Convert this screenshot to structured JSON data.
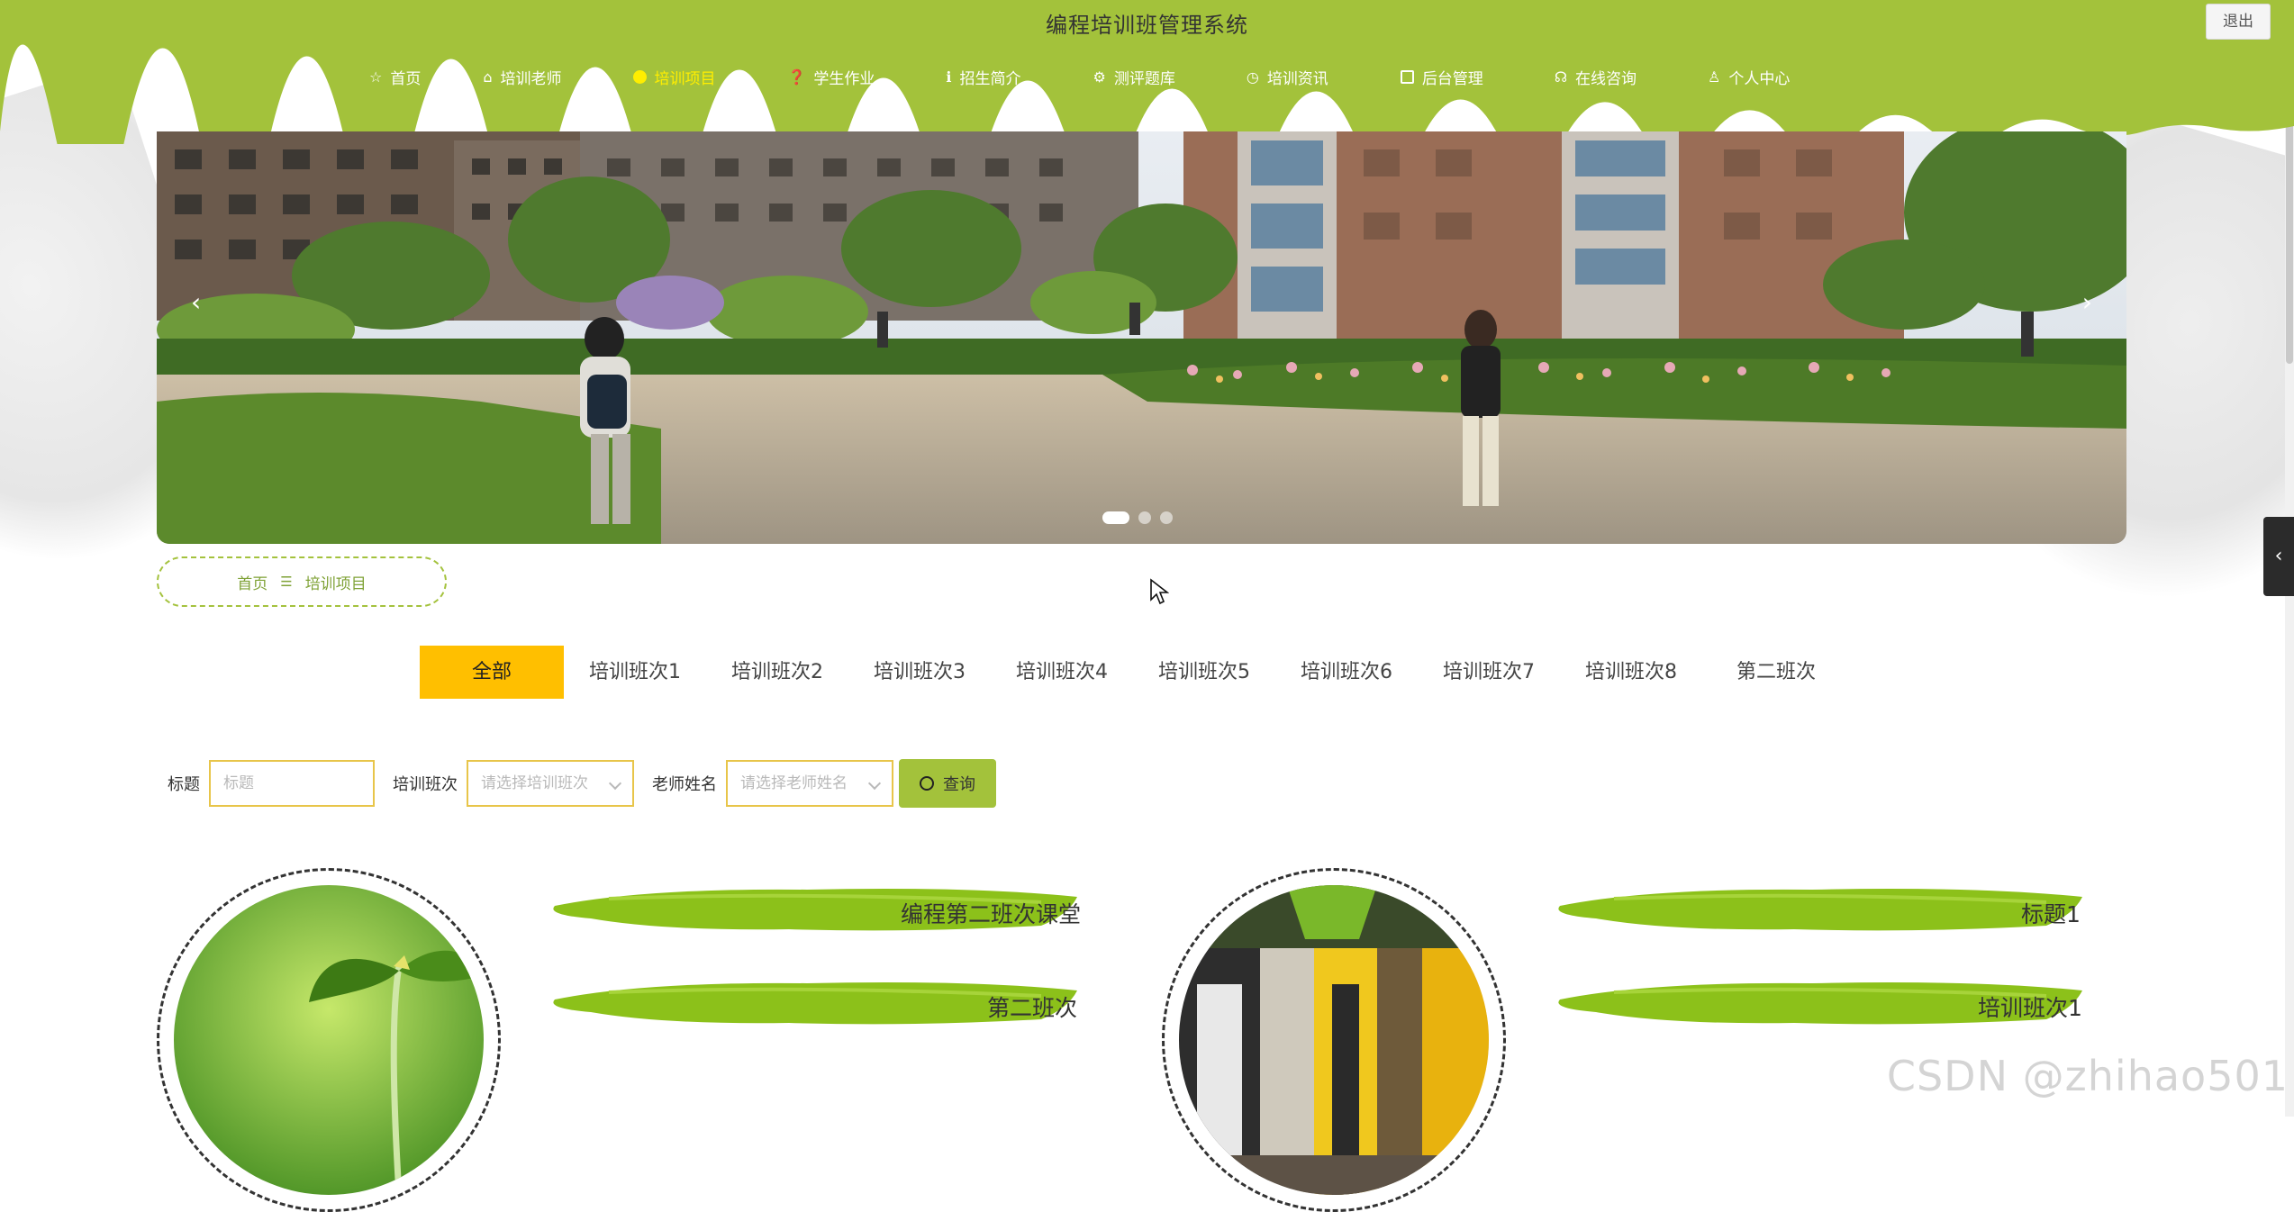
{
  "header": {
    "title": "编程培训班管理系统",
    "logout_label": "退出",
    "bg_color": "#a3c23b",
    "nav": [
      {
        "label": "首页",
        "icon": "star-icon",
        "active": false
      },
      {
        "label": "培训老师",
        "icon": "home-icon",
        "active": false
      },
      {
        "label": "培训项目",
        "icon": "dot-icon",
        "active": true
      },
      {
        "label": "学生作业",
        "icon": "question-icon",
        "active": false
      },
      {
        "label": "招生简介",
        "icon": "info-icon",
        "active": false
      },
      {
        "label": "测评题库",
        "icon": "gear-icon",
        "active": false
      },
      {
        "label": "培训资讯",
        "icon": "clock-icon",
        "active": false
      },
      {
        "label": "后台管理",
        "icon": "briefcase-icon",
        "active": false
      },
      {
        "label": "在线咨询",
        "icon": "headset-icon",
        "active": false
      },
      {
        "label": "个人中心",
        "icon": "user-icon",
        "active": false
      }
    ]
  },
  "banner": {
    "prev": "‹",
    "next": "›",
    "slides": 3,
    "active_slide": 1
  },
  "side_tab": {
    "icon": "chevron-left-icon",
    "glyph": "‹"
  },
  "breadcrumb": {
    "home": "首页",
    "separator": "☰",
    "current": "培训项目"
  },
  "categories": {
    "items": [
      "全部",
      "培训班次1",
      "培训班次2",
      "培训班次3",
      "培训班次4",
      "培训班次5",
      "培训班次6",
      "培训班次7",
      "培训班次8",
      "第二班次"
    ],
    "active_index": 0,
    "active_color": "#ffbf00"
  },
  "search": {
    "title_label": "标题",
    "title_placeholder": "标题",
    "class_label": "培训班次",
    "class_placeholder": "请选择培训班次",
    "teacher_label": "老师姓名",
    "teacher_placeholder": "请选择老师姓名",
    "button_label": "查询"
  },
  "cards": [
    {
      "line1": "编程第二班次课堂",
      "line2": "第二班次",
      "image": "sprout-photo"
    },
    {
      "line1": "标题1",
      "line2": "培训班次1",
      "image": "interior-photo"
    }
  ],
  "watermark": "CSDN @zhihao501"
}
